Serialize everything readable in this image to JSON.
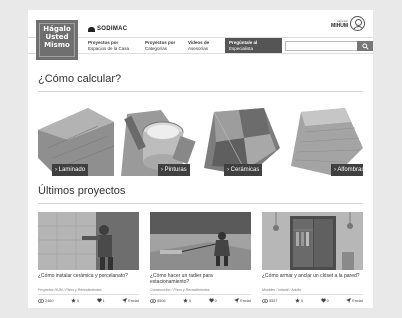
{
  "header": {
    "logo_lines": [
      "Hágalo",
      "Usted",
      "Mismo"
    ],
    "brand": "SODIMAC",
    "user_line1": "Ingresar",
    "user_line2": "MIHUM"
  },
  "nav": {
    "items": [
      {
        "bold": "Proyectos por",
        "text": "Espacios de la Casa"
      },
      {
        "bold": "Proyectos por",
        "text": "Categorías"
      },
      {
        "bold": "Videos de",
        "text": "Asesorías"
      }
    ],
    "cta": {
      "bold": "Pregúntale al",
      "text": "Especialista"
    },
    "search_placeholder": ""
  },
  "calc_section": {
    "title": "¿Cómo calcular?",
    "items": [
      {
        "label": "Laminado"
      },
      {
        "label": "Pinturas"
      },
      {
        "label": "Cerámicas"
      },
      {
        "label": "Alfombras"
      }
    ]
  },
  "projects_section": {
    "title": "Últimos proyectos",
    "items": [
      {
        "title": "¿Cómo instalar cerámica y porcelanato?",
        "category": "Proyectos HUM / Pisos y Revestimientos",
        "views": "2460",
        "stars": "0",
        "likes": "1",
        "share": "Enviar"
      },
      {
        "title": "¿Cómo hacer un radier para estacionamiento?",
        "category": "Construcción / Pisos y Revestimientos",
        "views": "6506",
        "stars": "0",
        "likes": "0",
        "share": "Enviar"
      },
      {
        "title": "¿Cómo armar y anclar un clóset a la pared?",
        "category": "Muebles / Infantil / Adulto",
        "views": "5557",
        "stars": "0",
        "likes": "0",
        "share": "Enviar"
      }
    ]
  },
  "colors": {
    "nav_cta": "#555555",
    "label_bg": "#3f3f3f",
    "page_bg": "#e9e9e9"
  }
}
